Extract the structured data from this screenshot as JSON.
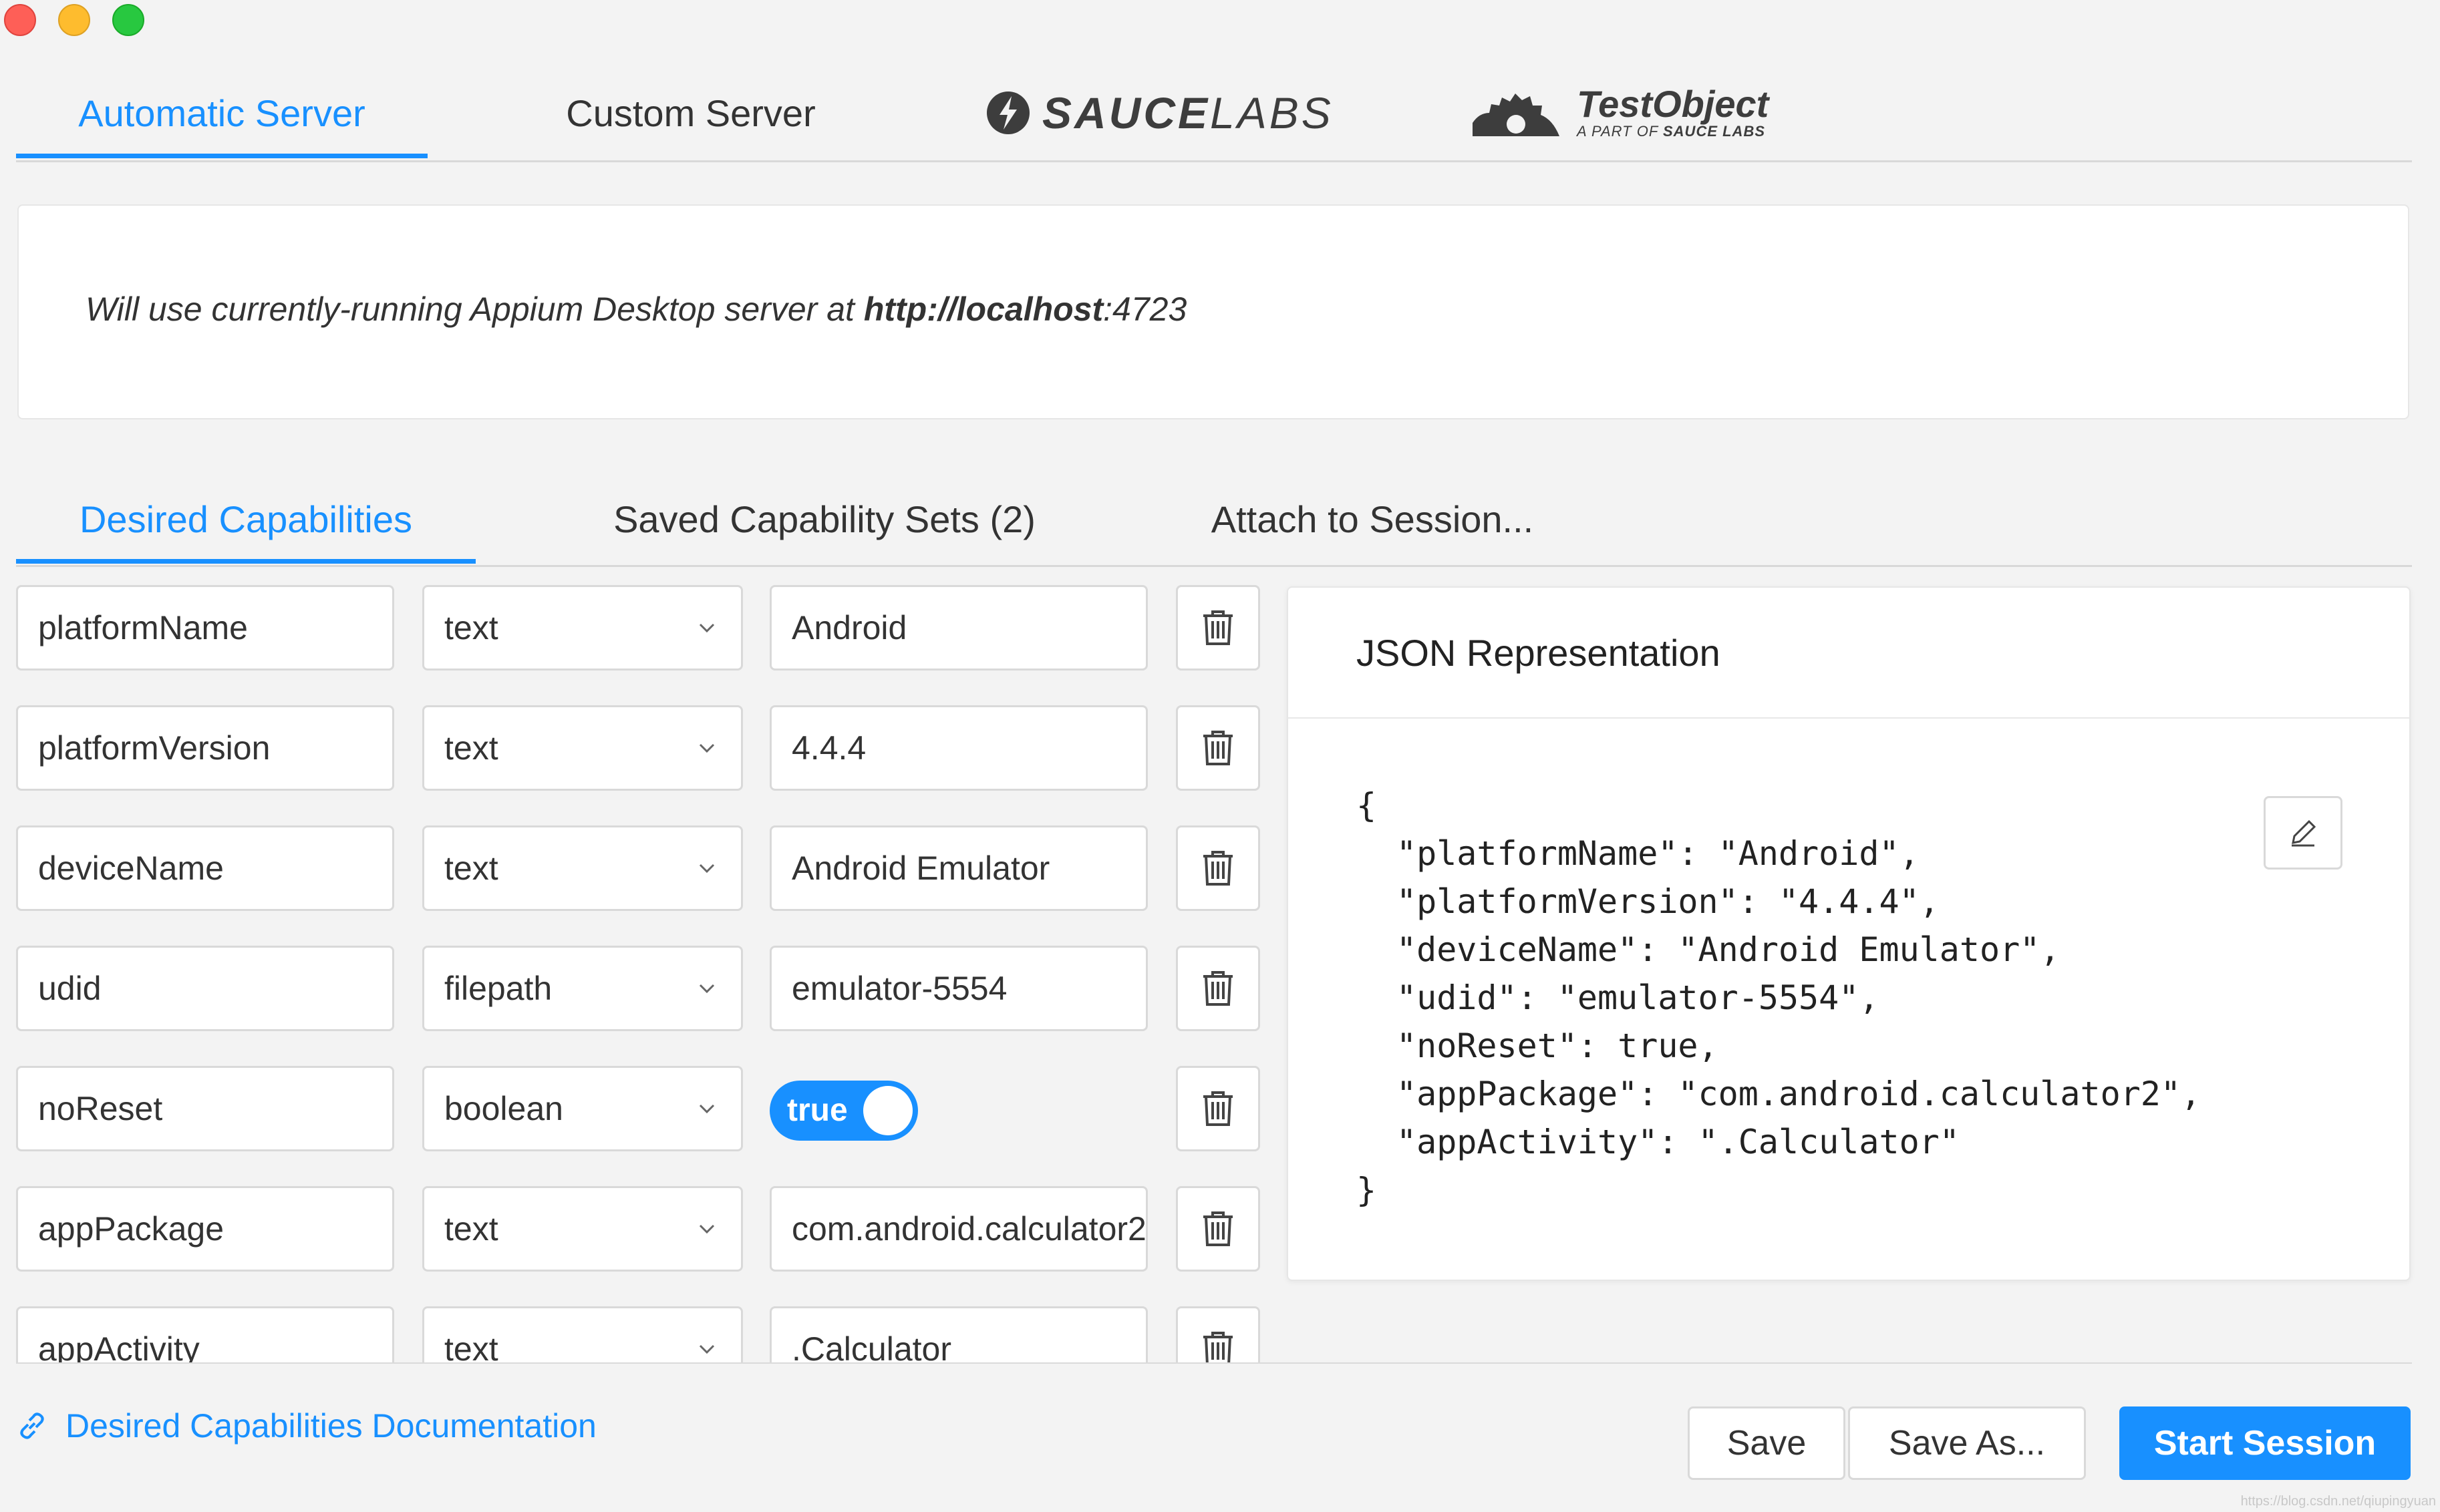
{
  "server_tabs": {
    "automatic": "Automatic Server",
    "custom": "Custom Server"
  },
  "logos": {
    "saucelabs": {
      "bold": "SAUCE",
      "light": "LABS"
    },
    "testobject": {
      "name": "TestObject",
      "tagline_prefix": "A PART OF ",
      "tagline_brand": "SAUCE LABS"
    }
  },
  "server_info": {
    "prefix": "Will use currently-running Appium Desktop server at ",
    "url_bold": "http://localhost",
    "port": ":4723"
  },
  "capability_tabs": {
    "desired": "Desired Capabilities",
    "saved": "Saved Capability Sets (2)",
    "attach": "Attach to Session..."
  },
  "capabilities": [
    {
      "name": "platformName",
      "type": "text",
      "value": "Android"
    },
    {
      "name": "platformVersion",
      "type": "text",
      "value": "4.4.4"
    },
    {
      "name": "deviceName",
      "type": "text",
      "value": "Android Emulator"
    },
    {
      "name": "udid",
      "type": "filepath",
      "value": "emulator-5554"
    },
    {
      "name": "noReset",
      "type": "boolean",
      "value": "true"
    },
    {
      "name": "appPackage",
      "type": "text",
      "value": "com.android.calculator2"
    },
    {
      "name": "appActivity",
      "type": "text",
      "value": ".Calculator"
    }
  ],
  "json_panel": {
    "title": "JSON Representation",
    "open": "{",
    "lines": [
      "\"platformName\": \"Android\",",
      "\"platformVersion\": \"4.4.4\",",
      "\"deviceName\": \"Android Emulator\",",
      "\"udid\": \"emulator-5554\",",
      "\"noReset\": true,",
      "\"appPackage\": \"com.android.calculator2\",",
      "\"appActivity\": \".Calculator\""
    ],
    "close": "}"
  },
  "footer": {
    "doc_link": "Desired Capabilities Documentation",
    "save": "Save",
    "save_as": "Save As...",
    "start_session": "Start Session"
  },
  "watermark": "https://blog.csdn.net/qiupingyuan",
  "colors": {
    "accent": "#1890ff",
    "background": "#f3f3f3",
    "close": "#fe5f57",
    "minimize": "#febc2e",
    "maximize": "#28c840"
  }
}
